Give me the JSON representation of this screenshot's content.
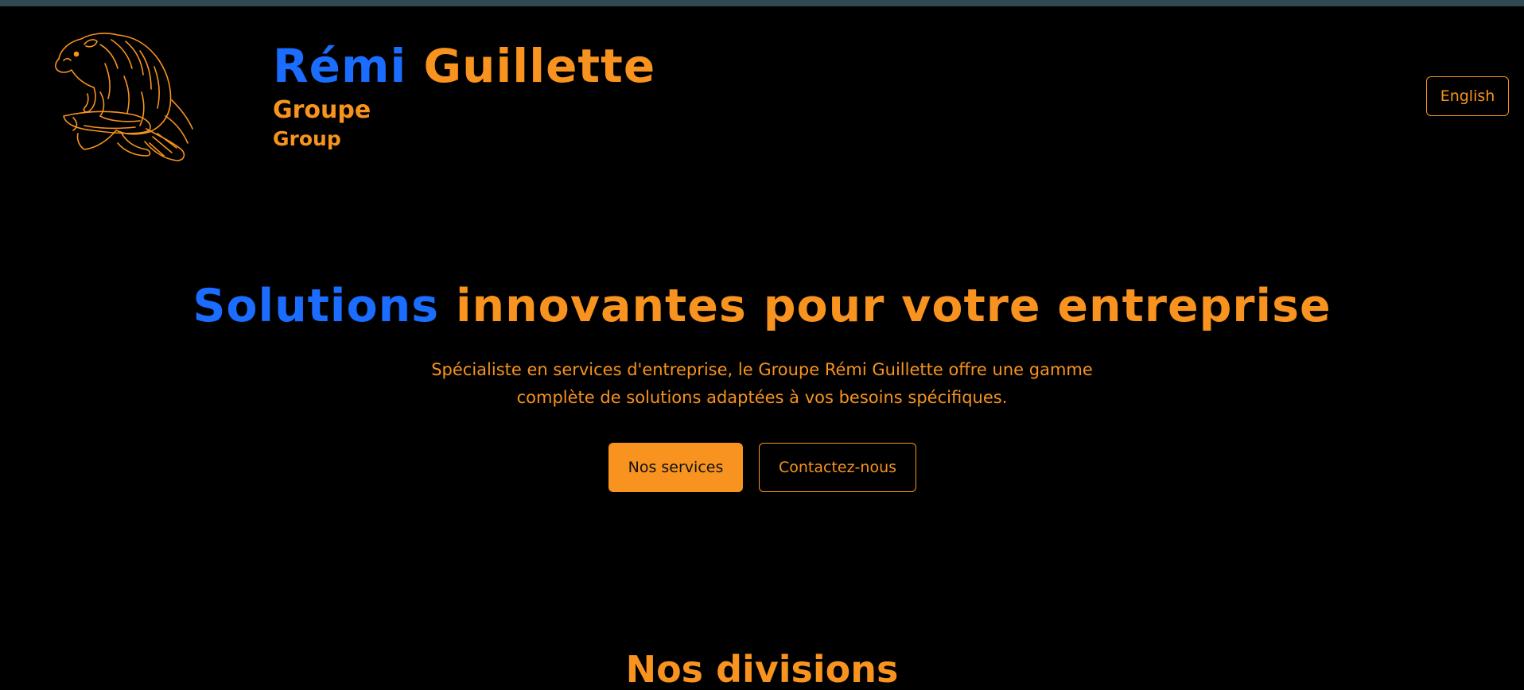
{
  "colors": {
    "background": "#000000",
    "top_bar": "#2f4a52",
    "accent_blue": "#1a6dff",
    "accent_orange": "#f7931e",
    "button_text_dark": "#111111"
  },
  "header": {
    "logo_icon": "beaver-illustration-icon",
    "brand_first": "Rémi",
    "brand_last": "Guillette",
    "brand_sub_fr": "Groupe",
    "brand_sub_en": "Group",
    "language_toggle": "English"
  },
  "hero": {
    "title_highlight": "Solutions",
    "title_rest": "innovantes pour votre entreprise",
    "description_line1": "Spécialiste en services d'entreprise, le Groupe Rémi Guillette offre une gamme",
    "description_line2": "complète de solutions adaptées à vos besoins spécifiques.",
    "primary_button": "Nos services",
    "secondary_button": "Contactez-nous"
  },
  "divisions": {
    "title": "Nos divisions"
  }
}
